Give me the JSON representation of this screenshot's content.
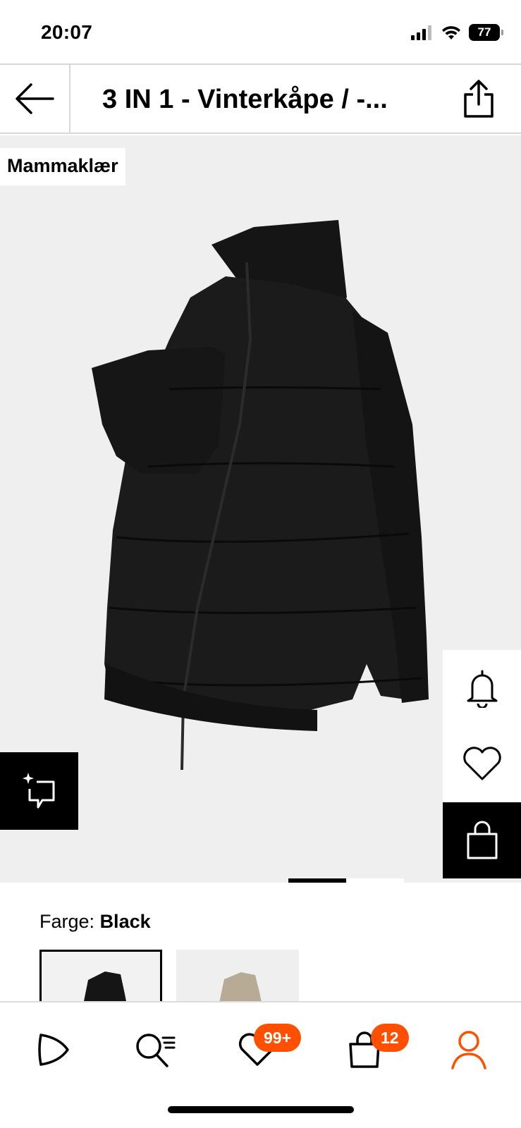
{
  "status_bar": {
    "time": "20:07",
    "battery": "77"
  },
  "header": {
    "title": "3 IN 1 - Vinterkåpe / -..."
  },
  "product": {
    "category_tag": "Mammaklær"
  },
  "color": {
    "label": "Farge:",
    "value": "Black"
  },
  "nav": {
    "wishlist_badge": "99+",
    "cart_badge": "12"
  },
  "colors": {
    "accent": "#ff4f00",
    "image_bg": "#efefef"
  }
}
